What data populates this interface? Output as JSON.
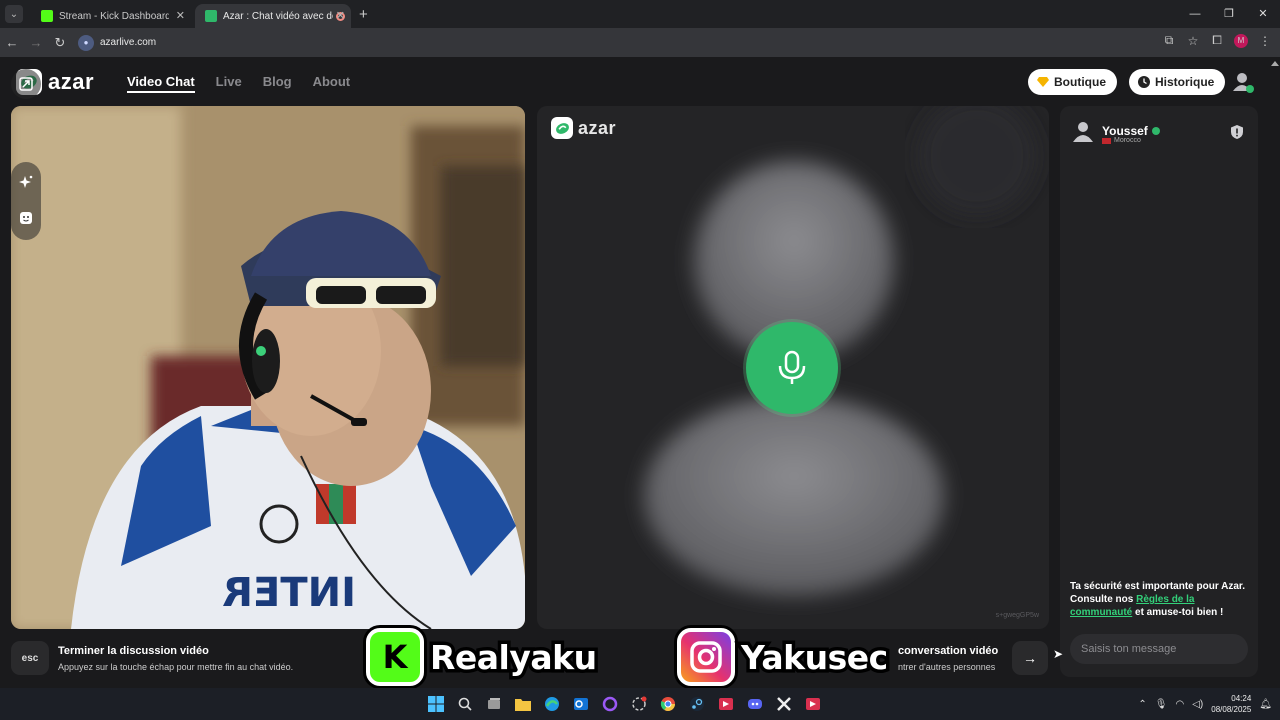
{
  "browser": {
    "tabs": [
      {
        "title": "Stream - Kick Dashboard",
        "active": false
      },
      {
        "title": "Azar : Chat vidéo avec de n",
        "active": true
      }
    ],
    "url": "azarlive.com",
    "profile_initial": "M"
  },
  "header": {
    "logo_text": "azar",
    "nav": [
      "Video Chat",
      "Live",
      "Blog",
      "About"
    ],
    "active_nav": "Video Chat",
    "boutique_label": "Boutique",
    "historique_label": "Historique"
  },
  "partner": {
    "logo_text": "azar",
    "id_text": "s+gwegGP5w"
  },
  "chat": {
    "user_name": "Youssef",
    "country": "Morocco",
    "safety_text_1": "Ta sécurité est importante pour Azar. Consulte nos ",
    "safety_link": "Règles de la communauté",
    "safety_text_2": " et amuse-toi bien !",
    "input_placeholder": "Saisis ton message"
  },
  "hints": {
    "esc_key": "esc",
    "end_title": "Terminer la discussion vidéo",
    "end_sub": "Appuyez sur la touche échap pour mettre fin au chat vidéo.",
    "next_title": "conversation vidéo",
    "next_sub": "ntrer d'autres personnes"
  },
  "overlays": {
    "kick_handle": "Realyaku",
    "instagram_handle": "Yakusec"
  },
  "taskbar": {
    "time": "04:24",
    "date": "08/08/2025"
  },
  "colors": {
    "accent_green": "#2fb86a",
    "link_green": "#33d17a",
    "kick_green": "#53fc18"
  }
}
